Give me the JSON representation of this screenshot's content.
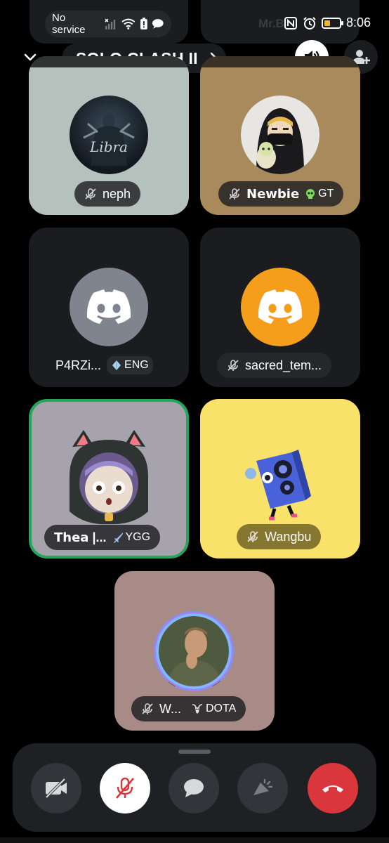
{
  "status_bar": {
    "carrier_text": "No service",
    "time": "8:06",
    "icons": [
      "signal-x-icon",
      "wifi-icon",
      "battery-saver-icon",
      "chat-bubble-icon",
      "nfc-icon",
      "alarm-icon",
      "battery-icon"
    ]
  },
  "ghost_row": {
    "left_label": "",
    "right_label": "Mr.B"
  },
  "header": {
    "channel_name": "SOLO CLASH II",
    "collapse_icon": "chevron-down-icon",
    "speaker_icon": "speaker-icon",
    "add_user_icon": "add-user-icon"
  },
  "participants": [
    {
      "name": "neph",
      "muted": true,
      "tag": "",
      "avatar": "dark-figure-avatar",
      "bg": "#b5c1bc"
    },
    {
      "name": "𝗡𝗲𝘄𝗯𝗶𝗲",
      "muted": true,
      "tag": "GT",
      "tag_icon": "skull-icon",
      "avatar": "hooded-ninja-avatar",
      "bg": "#a98a5c"
    },
    {
      "name": "P4RZi...",
      "muted": false,
      "tag": "ENG",
      "tag_icon": "crystal-icon",
      "avatar": "discord-logo",
      "bg": "#1b1c1f",
      "logo_color": "#80848e"
    },
    {
      "name": "sacred_tem...",
      "muted": true,
      "tag": "",
      "avatar": "discord-logo",
      "bg": "#1b1c1f",
      "logo_color": "#f59e1b"
    },
    {
      "name": "𝗧𝗵𝗲𝗮 |...",
      "muted": false,
      "speaking": true,
      "tag": "YGG",
      "tag_icon": "sword-icon",
      "avatar": "cat-hood-girl-avatar",
      "bg": "#a6a3ad"
    },
    {
      "name": "Wangbu",
      "muted": true,
      "tag": "",
      "avatar": "blue-speaker-creature-avatar",
      "bg": "#f9e26a"
    },
    {
      "name": "W...",
      "muted": true,
      "tag": "DOTA",
      "tag_icon": "goat-icon",
      "avatar": "soldier-portrait-avatar",
      "bg": "#a88a86"
    }
  ],
  "controls": {
    "camera": "camera-off-icon",
    "mic": "mic-off-icon",
    "chat": "chat-icon",
    "soundboard": "soundboard-icon",
    "hangup": "hang-up-icon"
  }
}
